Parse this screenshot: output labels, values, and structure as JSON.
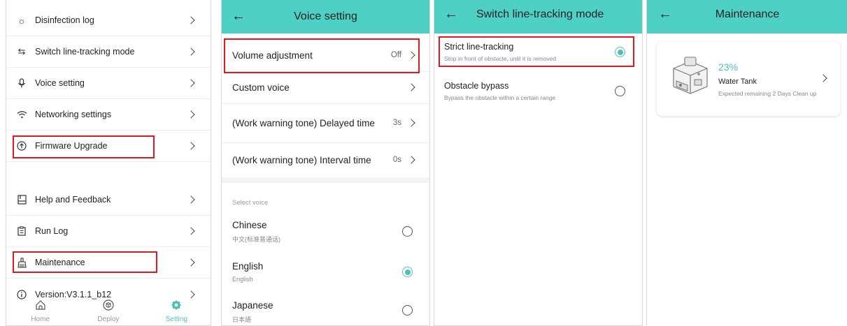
{
  "settings_panel": {
    "items": [
      {
        "icon": "sun-icon",
        "label": "Disinfection log"
      },
      {
        "icon": "switch-icon",
        "label": "Switch line-tracking mode"
      },
      {
        "icon": "microphone-icon",
        "label": "Voice setting"
      },
      {
        "icon": "wifi-icon",
        "label": "Networking settings"
      },
      {
        "icon": "upgrade-icon",
        "label": "Firmware Upgrade"
      },
      {
        "icon": "book-icon",
        "label": "Help and Feedback"
      },
      {
        "icon": "clipboard-icon",
        "label": "Run Log"
      },
      {
        "icon": "broom-icon",
        "label": "Maintenance"
      },
      {
        "icon": "info-icon",
        "label": "Version:V3.1.1_b12"
      }
    ],
    "tabs": [
      {
        "icon": "home-icon",
        "label": "Home"
      },
      {
        "icon": "cube-icon",
        "label": "Deploy"
      },
      {
        "icon": "gear-icon",
        "label": "Setting",
        "active": true
      }
    ]
  },
  "voice_panel": {
    "title": "Voice setting",
    "rows": [
      {
        "label": "Volume adjustment",
        "value": "Off"
      },
      {
        "label": "Custom voice",
        "value": ""
      },
      {
        "label": "(Work warning tone) Delayed time",
        "value": "3s"
      },
      {
        "label": "(Work warning tone) Interval time",
        "value": "0s"
      }
    ],
    "section_label": "Select voice",
    "voices": [
      {
        "name": "Chinese",
        "sub": "中文(标准普通话)",
        "selected": false
      },
      {
        "name": "English",
        "sub": "English",
        "selected": true
      },
      {
        "name": "Japanese",
        "sub": "日本語",
        "selected": false
      }
    ]
  },
  "tracking_panel": {
    "title": "Switch line-tracking mode",
    "options": [
      {
        "name": "Strict line-tracking",
        "sub": "Stop in front of obstacle, until it is removed",
        "selected": true
      },
      {
        "name": "Obstacle bypass",
        "sub": "Bypass the obstacle within a certain range",
        "selected": false
      }
    ]
  },
  "maintenance_panel": {
    "title": "Maintenance",
    "card": {
      "percent": "23%",
      "name": "Water Tank",
      "desc": "Expected remaining 2 Days Clean up"
    }
  },
  "colors": {
    "accent": "#4fd0c5",
    "highlight": "#e0191f"
  }
}
